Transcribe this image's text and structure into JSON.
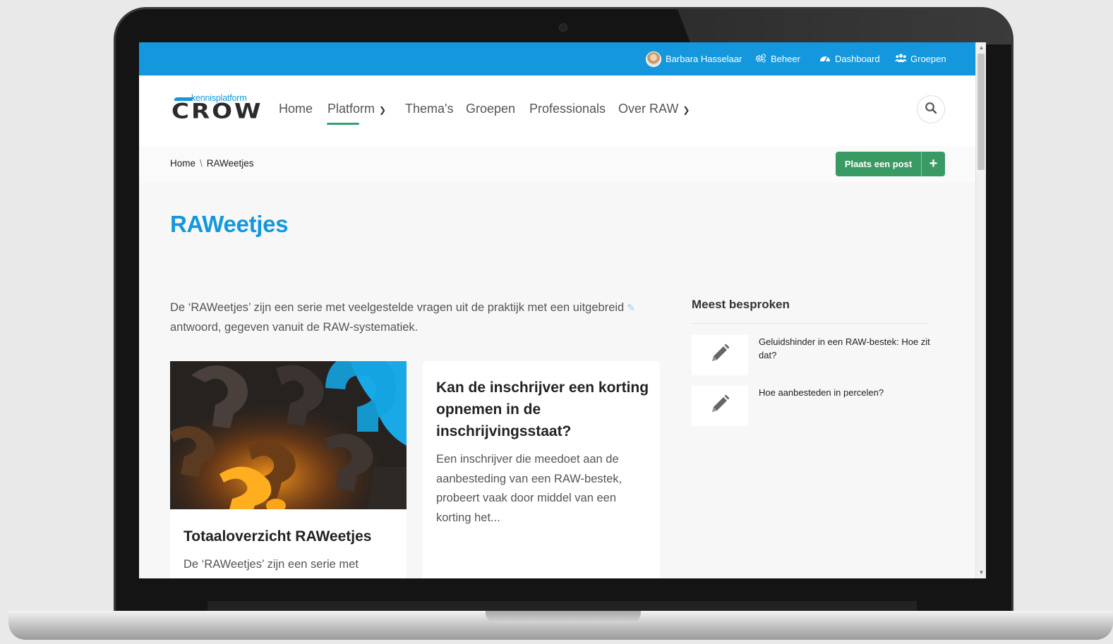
{
  "topbar": {
    "user_name": "Barbara Hasselaar",
    "beheer": "Beheer",
    "dashboard": "Dashboard",
    "groepen": "Groepen",
    "bg_color": "#1497dc"
  },
  "logo": {
    "small": "kennisplatform",
    "big": "CROW"
  },
  "nav": {
    "items": [
      "Home",
      "Platform",
      "Thema's",
      "Groepen",
      "Professionals",
      "Over RAW"
    ],
    "active": "Platform"
  },
  "breadcrumb": {
    "home": "Home",
    "separator": "\\",
    "current": "RAWeetjes"
  },
  "post_button": {
    "label": "Plaats een post",
    "plus": "+",
    "color": "#3a9a63"
  },
  "page": {
    "title": "RAWeetjes",
    "intro_line1": "De ‘RAWeetjes’ zijn een serie met veelgestelde vragen uit de praktijk met een uitgebreid",
    "intro_line2": "antwoord, gegeven vanuit de RAW-systematiek."
  },
  "cards": [
    {
      "title": "Totaaloverzicht RAWeetjes",
      "text": "De ‘RAWeetjes’ zijn een serie met"
    },
    {
      "title_line1": "Kan de inschrijver een korting",
      "title_line2": "opnemen in de",
      "title_line3": "inschrijvingsstaat?",
      "text_line1": "Een inschrijver die meedoet aan de",
      "text_line2": "aanbesteding van een RAW-bestek,",
      "text_line3": "probeert vaak door middel van een",
      "text_line4": "korting het..."
    }
  ],
  "sidebar": {
    "title": "Meest besproken",
    "items": [
      {
        "line1": "Geluidshinder in een RAW-bestek: Hoe zit",
        "line2": "dat?"
      },
      {
        "line1": "Hoe aanbesteden in percelen?",
        "line2": ""
      }
    ]
  }
}
